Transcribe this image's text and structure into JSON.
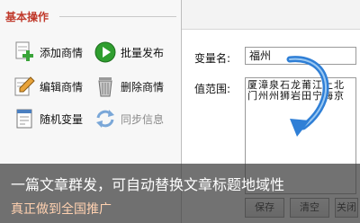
{
  "left_panel": {
    "header": "基本操作",
    "ops": [
      {
        "label": "添加商情",
        "icon": "add-plus-icon"
      },
      {
        "label": "批量发布",
        "icon": "play-arrow-icon"
      },
      {
        "label": "编辑商情",
        "icon": "edit-pencil-icon"
      },
      {
        "label": "删除商情",
        "icon": "trash-icon"
      },
      {
        "label": "随机变量",
        "icon": "document-icon"
      },
      {
        "label": "同步信息",
        "icon": "sync-arrows-icon"
      }
    ]
  },
  "form": {
    "variable_label": "变量名:",
    "variable_value": "福州",
    "range_label": "值范围:",
    "range_columns": [
      "厦门",
      "漳州",
      "泉州",
      "石狮",
      "龙岩",
      "莆田",
      "江宁",
      "上海",
      "北京"
    ]
  },
  "buttons": {
    "save": "保存",
    "clear": "清空",
    "third": "关闭"
  },
  "caption": {
    "line1": "一篇文章群发，可自动替换文章标题地域性",
    "line2": "真正做到全国推广"
  },
  "colors": {
    "header_red": "#c0392b",
    "arrow_blue": "#2f7fd6",
    "caption_overlay": "#3c3c3c"
  }
}
